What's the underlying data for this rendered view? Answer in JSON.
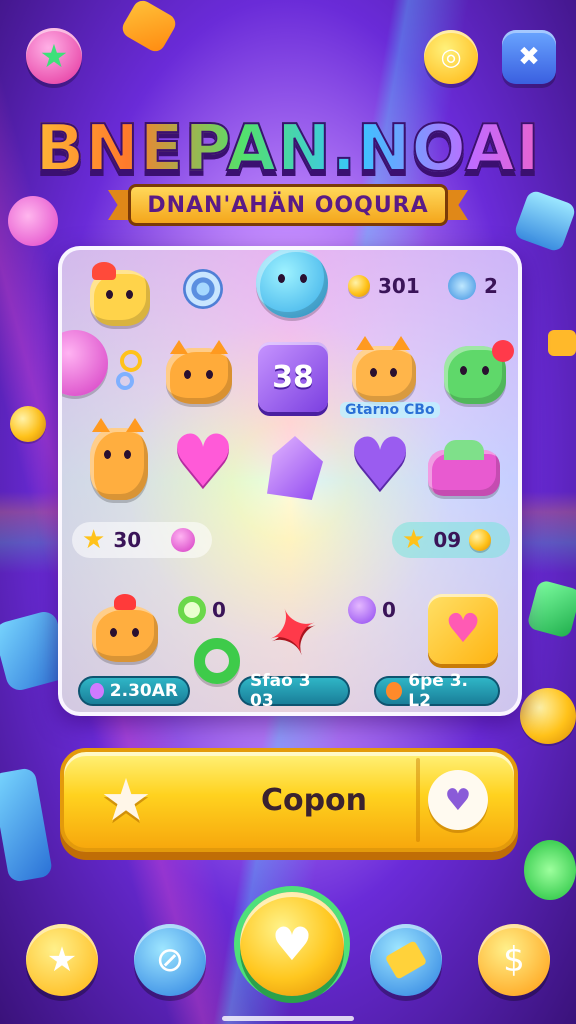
{
  "game": {
    "title": "BNEPAN.NOAI",
    "subtitle": "DNAN'AHÄN OOQURA"
  },
  "top_bar": {
    "left_icon": "star-badge-icon",
    "right_icons": [
      "coin-shop-icon",
      "puzzle-menu-icon"
    ]
  },
  "board": {
    "stat_top_a": "301",
    "stat_top_b": "2",
    "tile_label_38": "38",
    "creature_tag": "Gtarno CBo",
    "pill_left_value": "30",
    "pill_right_value": "09",
    "counter_mid_a": "0",
    "counter_mid_b": "0",
    "footer_pills": [
      {
        "label": "2.30AR",
        "icon": "gem-icon"
      },
      {
        "label": "Sfao 3 03",
        "icon": "ring-icon"
      },
      {
        "label": "6pe 3. L2",
        "icon": "fruit-icon"
      }
    ]
  },
  "main_button": {
    "label": "Copon"
  },
  "bottom_nav": [
    {
      "name": "star",
      "icon": "star-icon"
    },
    {
      "name": "planet",
      "icon": "planet-icon"
    },
    {
      "name": "play",
      "icon": "heart-coin-icon"
    },
    {
      "name": "ticket",
      "icon": "ticket-icon"
    },
    {
      "name": "money",
      "icon": "dollar-icon"
    }
  ],
  "colors": {
    "accent_gold": "#ffd21f",
    "accent_purple": "#6a2bd8",
    "accent_teal": "#2fb5c6"
  }
}
